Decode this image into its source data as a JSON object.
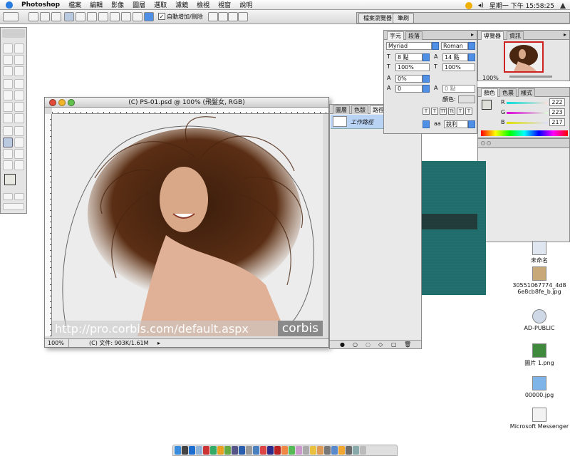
{
  "menubar": {
    "app": "Photoshop",
    "items": [
      "檔案",
      "編輯",
      "影像",
      "圖層",
      "選取",
      "濾鏡",
      "檢視",
      "視窗",
      "說明"
    ],
    "clock": "星期一 下午 15:58:25"
  },
  "options_bar": {
    "auto_add_delete": "自動增加/刪除",
    "auto_add_delete_checked": true,
    "wells": [
      "檔案瀏覽器",
      "筆刷"
    ]
  },
  "document": {
    "title": "(C) PS-01.psd @ 100% (飛髮女, RGB)",
    "zoom": "100%",
    "status": "(C) 文件: 903K/1.61M",
    "watermark_url": "http://pro.corbis.com/default.aspx",
    "watermark_brand": "corbis"
  },
  "paths_panel": {
    "tabs": [
      "圖層",
      "色版",
      "路徑"
    ],
    "active_tab": "路徑",
    "path_name": "工作路徑"
  },
  "character_panel": {
    "tabs": [
      "字元",
      "段落"
    ],
    "font": "Myriad",
    "style": "Roman",
    "size": "8 點",
    "leading": "14 點",
    "vscale": "100%",
    "hscale": "100%",
    "kerning": "0%",
    "tracking": "0",
    "baseline": "0 點",
    "color_label": "顏色:",
    "antialias": "銳利",
    "aa_label": "aa"
  },
  "navigator_panel": {
    "tabs": [
      "導覽器",
      "資訊"
    ],
    "zoom": "100%"
  },
  "color_panel": {
    "tabs": [
      "顏色",
      "色票",
      "樣式"
    ],
    "R": "222",
    "G": "223",
    "B": "217",
    "labels": {
      "r": "R",
      "g": "G",
      "b": "B"
    }
  },
  "desktop": {
    "icons": [
      "未命名",
      "30551067774_4d86e8cb8fe_b.jpg",
      "AD-PUBLIC",
      "圖片 1.png",
      "00000.jpg",
      "Microsoft Messenger"
    ]
  },
  "colors": {
    "selection": "#b9d3f5",
    "accent": "#4f8fe6",
    "navigator_frame": "#cc2222"
  }
}
